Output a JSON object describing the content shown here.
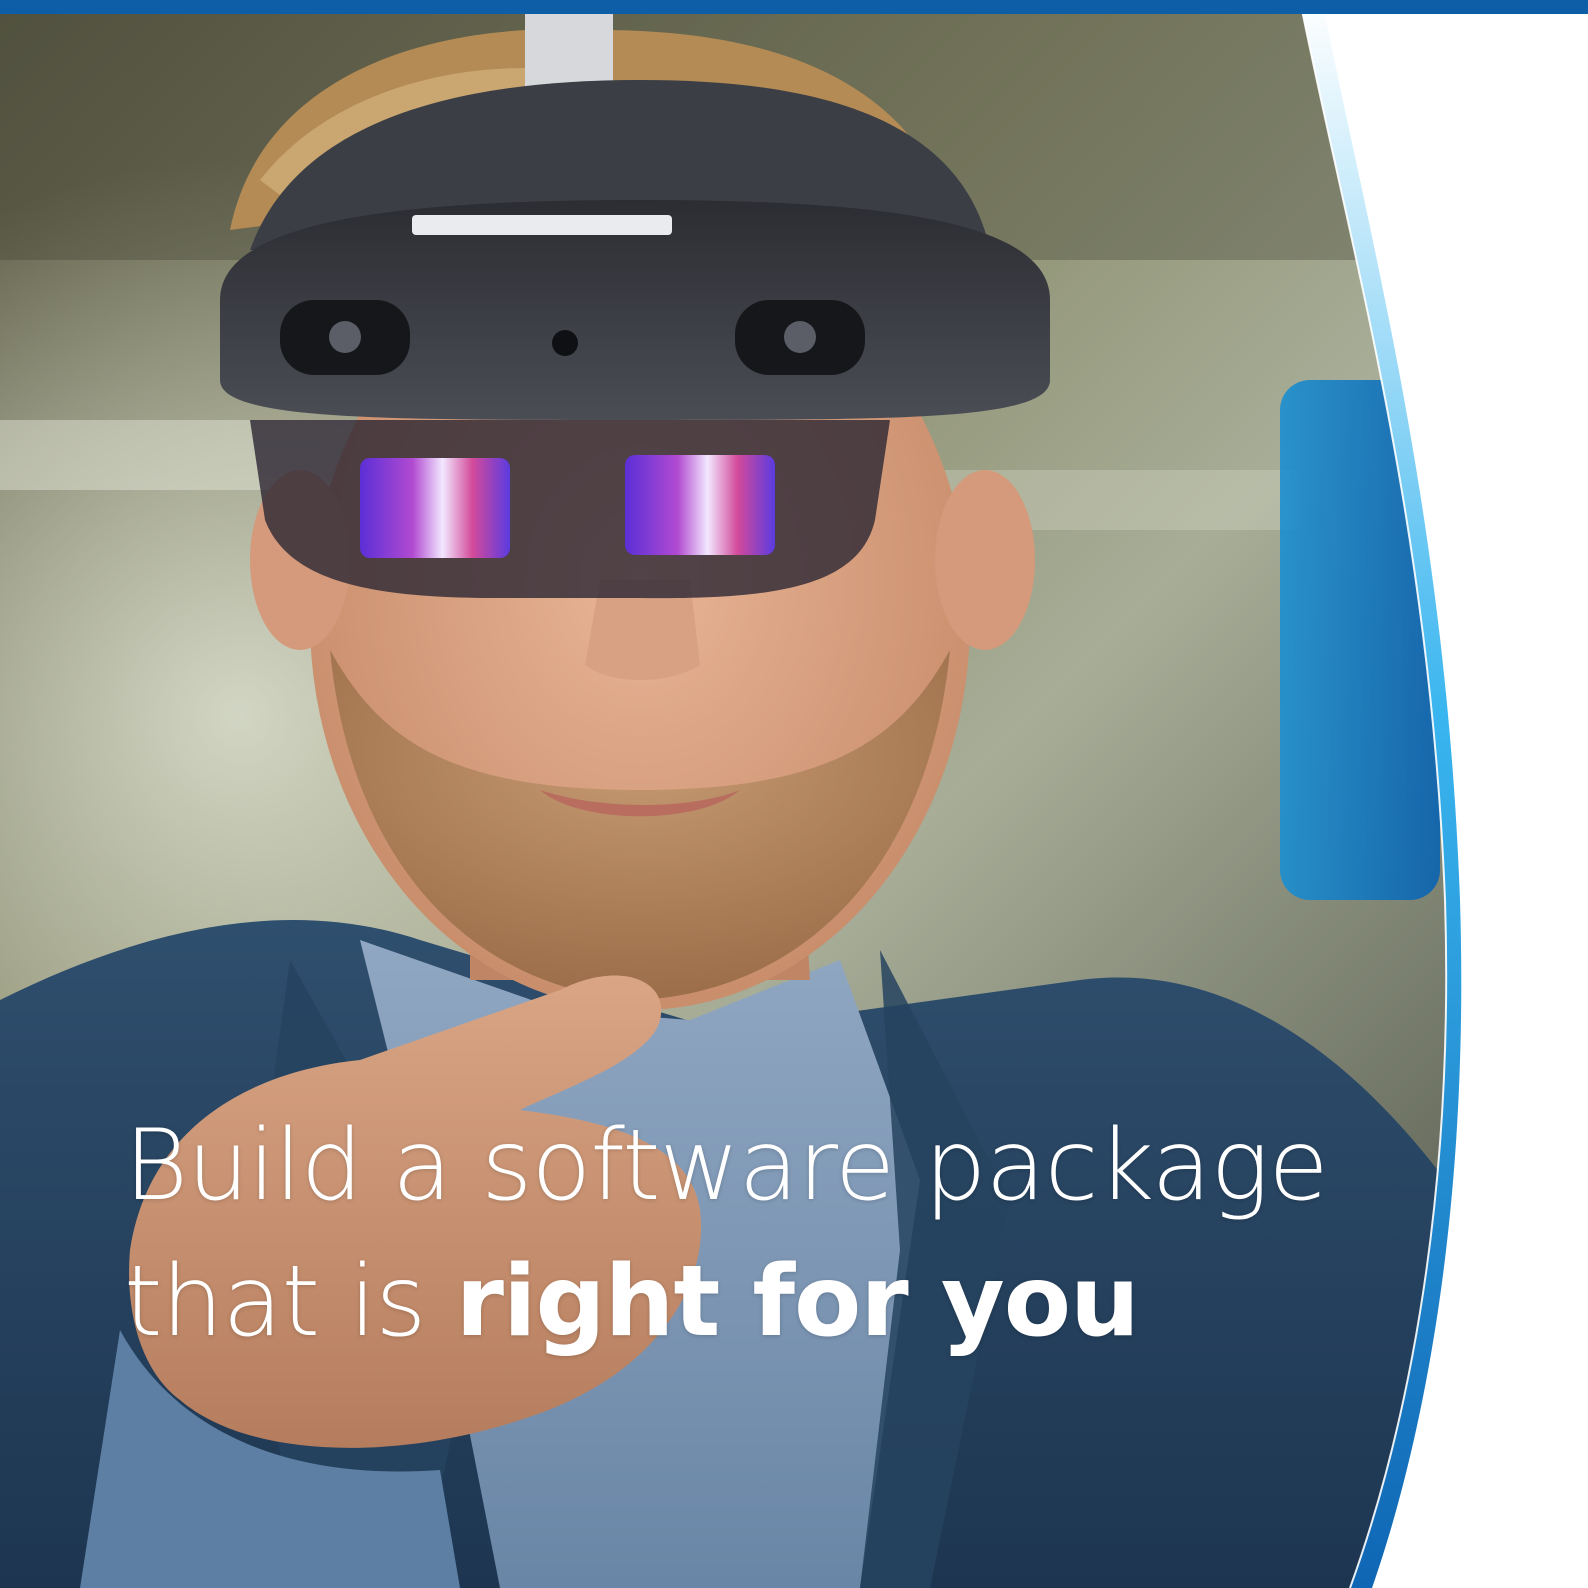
{
  "headline": {
    "line1": "Build a software package",
    "line2_prefix": "that is ",
    "line2_bold": "right for you"
  },
  "colors": {
    "brand_blue": "#0d5ea6",
    "accent_cyan": "#1aa3e6",
    "text": "#ffffff"
  },
  "photo": {
    "subject": "person-wearing-mixed-reality-headset",
    "icon": "photo-icon"
  }
}
